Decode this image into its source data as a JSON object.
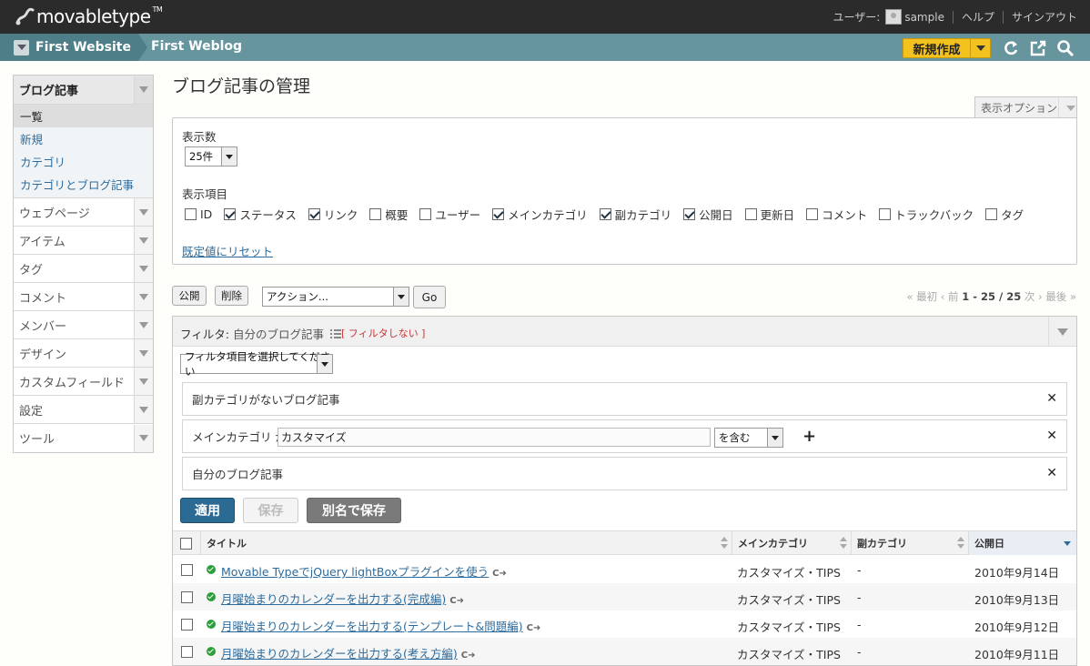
{
  "header": {
    "logo_text": "movabletype",
    "logo_tm": "TM",
    "user_label": "ユーザー:",
    "user_name": "sample",
    "help": "ヘルプ",
    "signout": "サインアウト"
  },
  "sitebar": {
    "website": "First Website",
    "blog": "First Weblog",
    "new_button": "新規作成",
    "icons": [
      "refresh-icon",
      "external-view-icon",
      "search-icon"
    ]
  },
  "sidebar": {
    "active": {
      "label": "ブログ記事",
      "items": [
        "一覧",
        "新規",
        "カテゴリ",
        "カテゴリとブログ記事"
      ]
    },
    "menus": [
      "ウェブページ",
      "アイテム",
      "タグ",
      "コメント",
      "メンバー",
      "デザイン",
      "カスタムフィールド",
      "設定",
      "ツール"
    ]
  },
  "page": {
    "title": "ブログ記事の管理",
    "display_options": "表示オプション"
  },
  "options": {
    "count_label": "表示数",
    "count_value": "25件",
    "columns_label": "表示項目",
    "columns": [
      {
        "label": "ID",
        "checked": false
      },
      {
        "label": "ステータス",
        "checked": true
      },
      {
        "label": "リンク",
        "checked": true
      },
      {
        "label": "概要",
        "checked": false
      },
      {
        "label": "ユーザー",
        "checked": false
      },
      {
        "label": "メインカテゴリ",
        "checked": true
      },
      {
        "label": "副カテゴリ",
        "checked": true
      },
      {
        "label": "公開日",
        "checked": true
      },
      {
        "label": "更新日",
        "checked": false
      },
      {
        "label": "コメント",
        "checked": false
      },
      {
        "label": "トラックバック",
        "checked": false
      },
      {
        "label": "タグ",
        "checked": false
      }
    ],
    "reset_link": "既定値にリセット"
  },
  "actions": {
    "publish": "公開",
    "delete": "削除",
    "action_select": "アクション...",
    "go": "Go"
  },
  "pager": {
    "first": "« 最初",
    "prev": "‹ 前",
    "range": "1 - 25 / 25",
    "next": "次 ›",
    "last": "最後 »"
  },
  "filter": {
    "label": "フィルタ:",
    "name": "自分のブログ記事",
    "no_filter": "[ フィルタしない ]",
    "select_placeholder": "フィルタ項目を選択してください",
    "rows": {
      "subcat": "副カテゴリがないブログ記事",
      "maincat_label": "メインカテゴリ が",
      "maincat_value": "カスタマイズ",
      "maincat_op": "を含む",
      "mine": "自分のブログ記事"
    },
    "apply": "適用",
    "save": "保存",
    "save_as": "別名で保存"
  },
  "table": {
    "headers": {
      "title": "タイトル",
      "main_category": "メインカテゴリ",
      "sub_category": "副カテゴリ",
      "published": "公開日"
    },
    "rows": [
      {
        "title": "Movable TypeでjQuery lightBoxプラグインを使う",
        "category": "カスタマイズ・TIPS",
        "sub": "-",
        "date": "2010年9月14日"
      },
      {
        "title": "月曜始まりのカレンダーを出力する(完成編)",
        "category": "カスタマイズ・TIPS",
        "sub": "-",
        "date": "2010年9月13日"
      },
      {
        "title": "月曜始まりのカレンダーを出力する(テンプレート&問題編)",
        "category": "カスタマイズ・TIPS",
        "sub": "-",
        "date": "2010年9月12日"
      },
      {
        "title": "月曜始まりのカレンダーを出力する(考え方編)",
        "category": "カスタマイズ・TIPS",
        "sub": "-",
        "date": "2010年9月11日"
      }
    ]
  }
}
